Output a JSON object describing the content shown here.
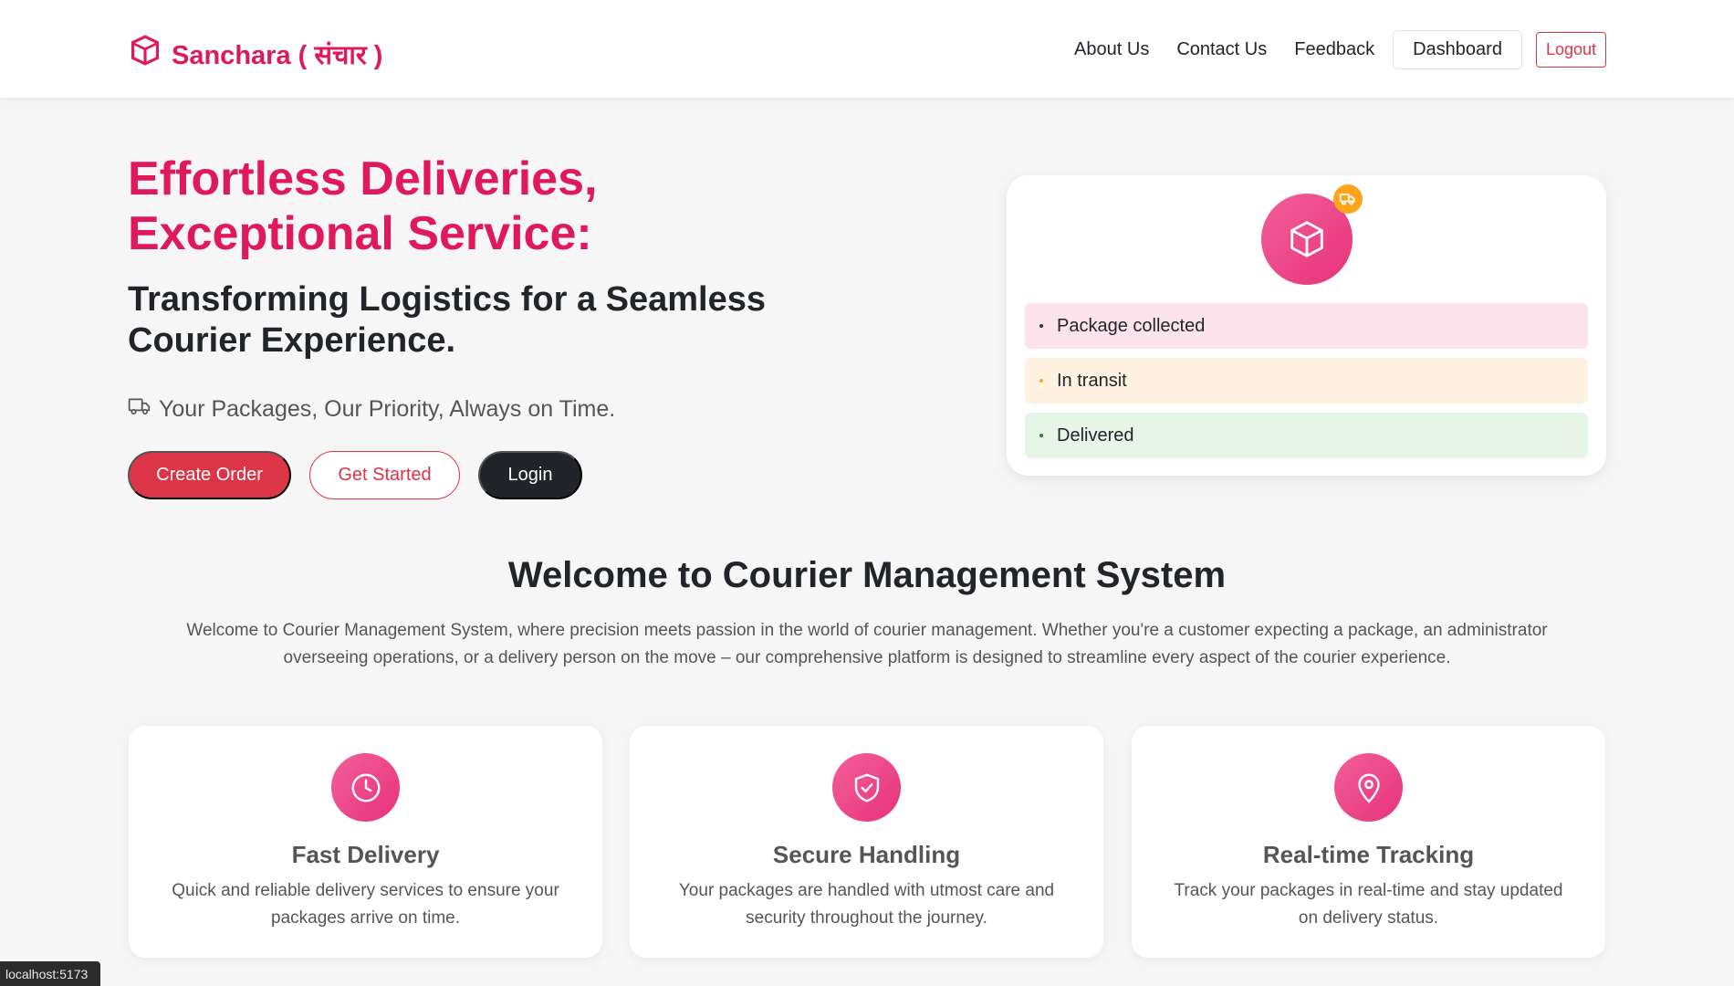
{
  "navbar": {
    "brand": "Sanchara ( संचार )",
    "links": [
      "About Us",
      "Contact Us",
      "Feedback"
    ],
    "dashboard_label": "Dashboard",
    "logout_label": "Logout"
  },
  "hero": {
    "title": "Effortless Deliveries, Exceptional Service:",
    "subtitle": "Transforming Logistics for a Seamless Courier Experience.",
    "tagline": "Your Packages, Our Priority, Always on Time.",
    "buttons": {
      "create": "Create Order",
      "started": "Get Started",
      "login": "Login"
    }
  },
  "status_card": {
    "steps": [
      "Package collected",
      "In transit",
      "Delivered"
    ]
  },
  "welcome": {
    "title": "Welcome to Courier Management System",
    "text": "Welcome to Courier Management System, where precision meets passion in the world of courier management. Whether you're a customer expecting a package, an administrator overseeing operations, or a delivery person on the move – our comprehensive platform is designed to streamline every aspect of the courier experience."
  },
  "features": [
    {
      "title": "Fast Delivery",
      "desc": "Quick and reliable delivery services to ensure your packages arrive on time.",
      "icon": "clock-icon"
    },
    {
      "title": "Secure Handling",
      "desc": "Your packages are handled with utmost care and security throughout the journey.",
      "icon": "shield-icon"
    },
    {
      "title": "Real-time Tracking",
      "desc": "Track your packages in real-time and stay updated on delivery status.",
      "icon": "location-pin-icon"
    }
  ],
  "statusbar": "localhost:5173",
  "colors": {
    "brand": "#e0195a",
    "danger": "#dc3545",
    "dark": "#212529",
    "accent_orange": "#ffa41b"
  }
}
